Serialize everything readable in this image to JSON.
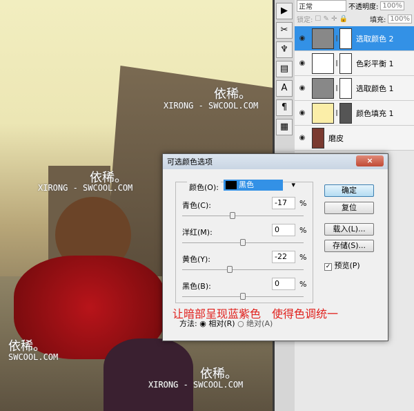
{
  "watermarks": {
    "a_cn": "依稀。",
    "a_en": "XIRONG - SWCOOL.COM",
    "b_cn": "依稀。",
    "b_en": "XIRONG - SWCOOL.COM",
    "c_cn": "依稀。",
    "c_en": "SWCOOL.COM",
    "d_cn": "依稀。",
    "d_en": "XIRONG - SWCOOL.COM"
  },
  "layers_panel": {
    "blend_mode": "正常",
    "opacity_label": "不透明度:",
    "opacity": "100%",
    "lock_label": "锁定:",
    "fill_label": "填充:",
    "fill": "100%",
    "layers": [
      {
        "name": "选取颜色 2",
        "selected": true
      },
      {
        "name": "色彩平衡 1"
      },
      {
        "name": "选取颜色 1"
      },
      {
        "name": "颜色填充 1"
      },
      {
        "name": "磨皮"
      }
    ]
  },
  "dialog": {
    "title": "可选颜色选项",
    "close": "×",
    "color_label": "颜色(O):",
    "color_value": "黑色",
    "sliders": [
      {
        "label": "青色(C):",
        "value": "-17"
      },
      {
        "label": "洋红(M):",
        "value": "0"
      },
      {
        "label": "黄色(Y):",
        "value": "-22"
      },
      {
        "label": "黑色(B):",
        "value": "0"
      }
    ],
    "pct": "%",
    "ok": "确定",
    "reset": "复位",
    "load": "载入(L)...",
    "save": "存储(S)...",
    "preview": "预览(P)",
    "preview_checked": true,
    "method_label": "方法:",
    "relative": "相对(R)",
    "absolute": "绝对(A)",
    "method_selected": "relative",
    "caption": "让暗部呈现蓝紫色　使得色调统一"
  },
  "colors": {
    "accent": "#3391e6",
    "caption": "#e0201c"
  }
}
